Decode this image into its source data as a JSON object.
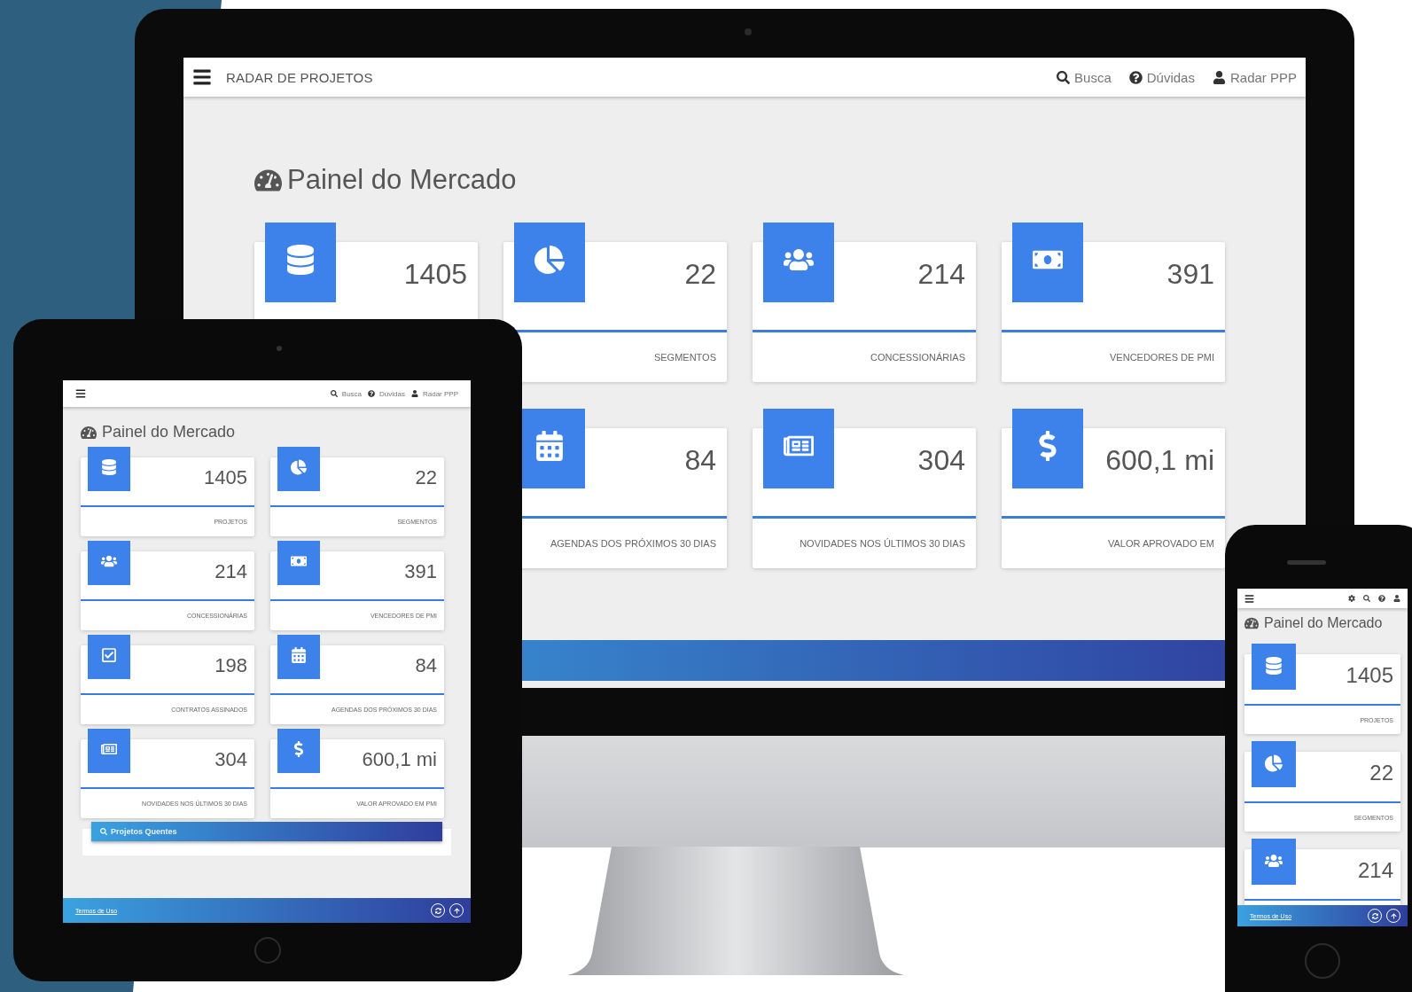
{
  "desktop": {
    "header": {
      "title": "RADAR DE PROJETOS",
      "links": [
        {
          "kind": "search",
          "label": "Busca"
        },
        {
          "kind": "help",
          "label": "Dúvidas"
        },
        {
          "kind": "user",
          "label": "Radar PPP"
        }
      ]
    },
    "page_title": "Painel do Mercado",
    "cards": [
      {
        "kind": "database",
        "value": "1405"
      },
      {
        "kind": "pie",
        "value": "22",
        "label": "SEGMENTOS"
      },
      {
        "kind": "users",
        "value": "214",
        "label": "CONCESSIONÁRIAS"
      },
      {
        "kind": "money",
        "value": "391",
        "label": "VENCEDORES DE PMI"
      },
      {
        "kind": "calendar",
        "value": "84",
        "label": "AGENDAS DOS PRÓXIMOS 30 DIAS"
      },
      {
        "kind": "news",
        "value": "304",
        "label": "NOVIDADES NOS ÚLTIMOS 30 DIAS"
      },
      {
        "kind": "dollar",
        "value": "600,1 mi",
        "label": "VALOR APROVADO EM"
      }
    ]
  },
  "tablet": {
    "header": {
      "links": [
        {
          "kind": "search",
          "label": "Busca"
        },
        {
          "kind": "help",
          "label": "Dúvidas"
        },
        {
          "kind": "user",
          "label": "Radar PPP"
        }
      ]
    },
    "page_title": "Painel do Mercado",
    "cards": [
      {
        "kind": "database",
        "value": "1405",
        "label": "PROJETOS"
      },
      {
        "kind": "pie",
        "value": "22",
        "label": "SEGMENTOS"
      },
      {
        "kind": "users",
        "value": "214",
        "label": "CONCESSIONÁRIAS"
      },
      {
        "kind": "money",
        "value": "391",
        "label": "VENCEDORES DE PMI"
      },
      {
        "kind": "check",
        "value": "198",
        "label": "CONTRATOS ASSINADOS"
      },
      {
        "kind": "calendar",
        "value": "84",
        "label": "AGENDAS DOS PRÓXIMOS 30 DIAS"
      },
      {
        "kind": "news",
        "value": "304",
        "label": "NOVIDADES NOS ÚLTIMOS 30 DIAS"
      },
      {
        "kind": "dollar",
        "value": "600,1 mi",
        "label": "VALOR APROVADO EM PMI"
      }
    ],
    "panel": {
      "title": "Projetos Quentes"
    },
    "footer": {
      "link": "Termos de Uso"
    }
  },
  "phone": {
    "page_title": "Painel do Mercado",
    "cards": [
      {
        "kind": "database",
        "value": "1405",
        "label": "PROJETOS"
      },
      {
        "kind": "pie",
        "value": "22",
        "label": "SEGMENTOS"
      },
      {
        "kind": "users",
        "value": "214"
      }
    ],
    "footer": {
      "link": "Termos de Uso"
    }
  }
}
